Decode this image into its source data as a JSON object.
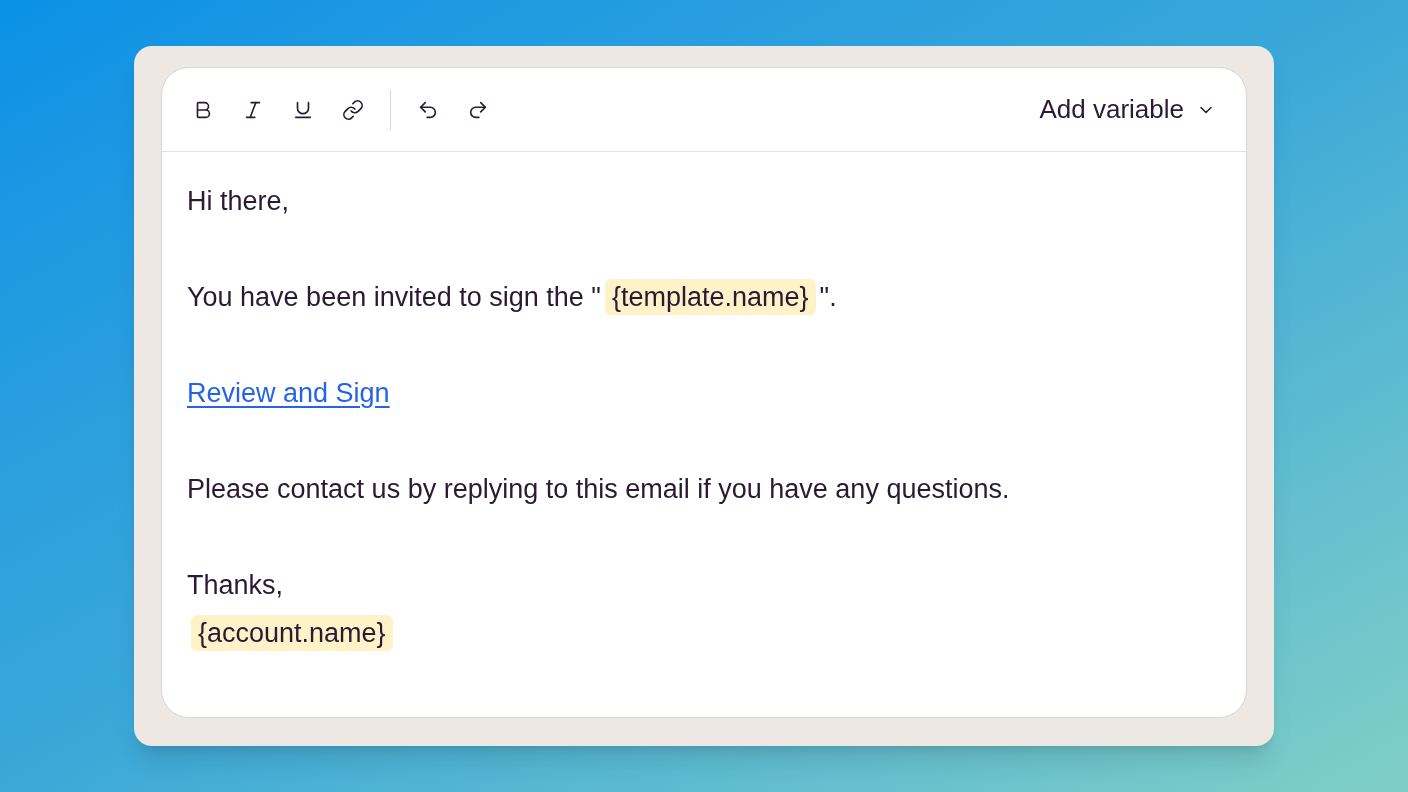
{
  "toolbar": {
    "tools": [
      {
        "kind": "bold"
      },
      {
        "kind": "italic"
      },
      {
        "kind": "underline"
      },
      {
        "kind": "link"
      },
      {
        "kind": "divider"
      },
      {
        "kind": "undo"
      },
      {
        "kind": "redo"
      }
    ],
    "menu": {
      "label": "Add variable"
    }
  },
  "body": [
    {
      "kind": "paragraph",
      "parts": [
        {
          "kind": "text",
          "text": "Hi there,"
        }
      ]
    },
    {
      "kind": "blank"
    },
    {
      "kind": "paragraph",
      "parts": [
        {
          "kind": "text",
          "text": "You have been invited to sign the \""
        },
        {
          "kind": "variable",
          "text": "{template.name}"
        },
        {
          "kind": "text",
          "text": "\"."
        }
      ]
    },
    {
      "kind": "blank"
    },
    {
      "kind": "paragraph",
      "parts": [
        {
          "kind": "link",
          "text": "Review and Sign"
        }
      ]
    },
    {
      "kind": "blank"
    },
    {
      "kind": "paragraph",
      "parts": [
        {
          "kind": "text",
          "text": "Please contact us by replying to this email if you have any questions."
        }
      ]
    },
    {
      "kind": "blank"
    },
    {
      "kind": "paragraph",
      "parts": [
        {
          "kind": "text",
          "text": "Thanks,"
        }
      ]
    },
    {
      "kind": "paragraph",
      "parts": [
        {
          "kind": "variable",
          "text": "{account.name}"
        }
      ]
    }
  ]
}
